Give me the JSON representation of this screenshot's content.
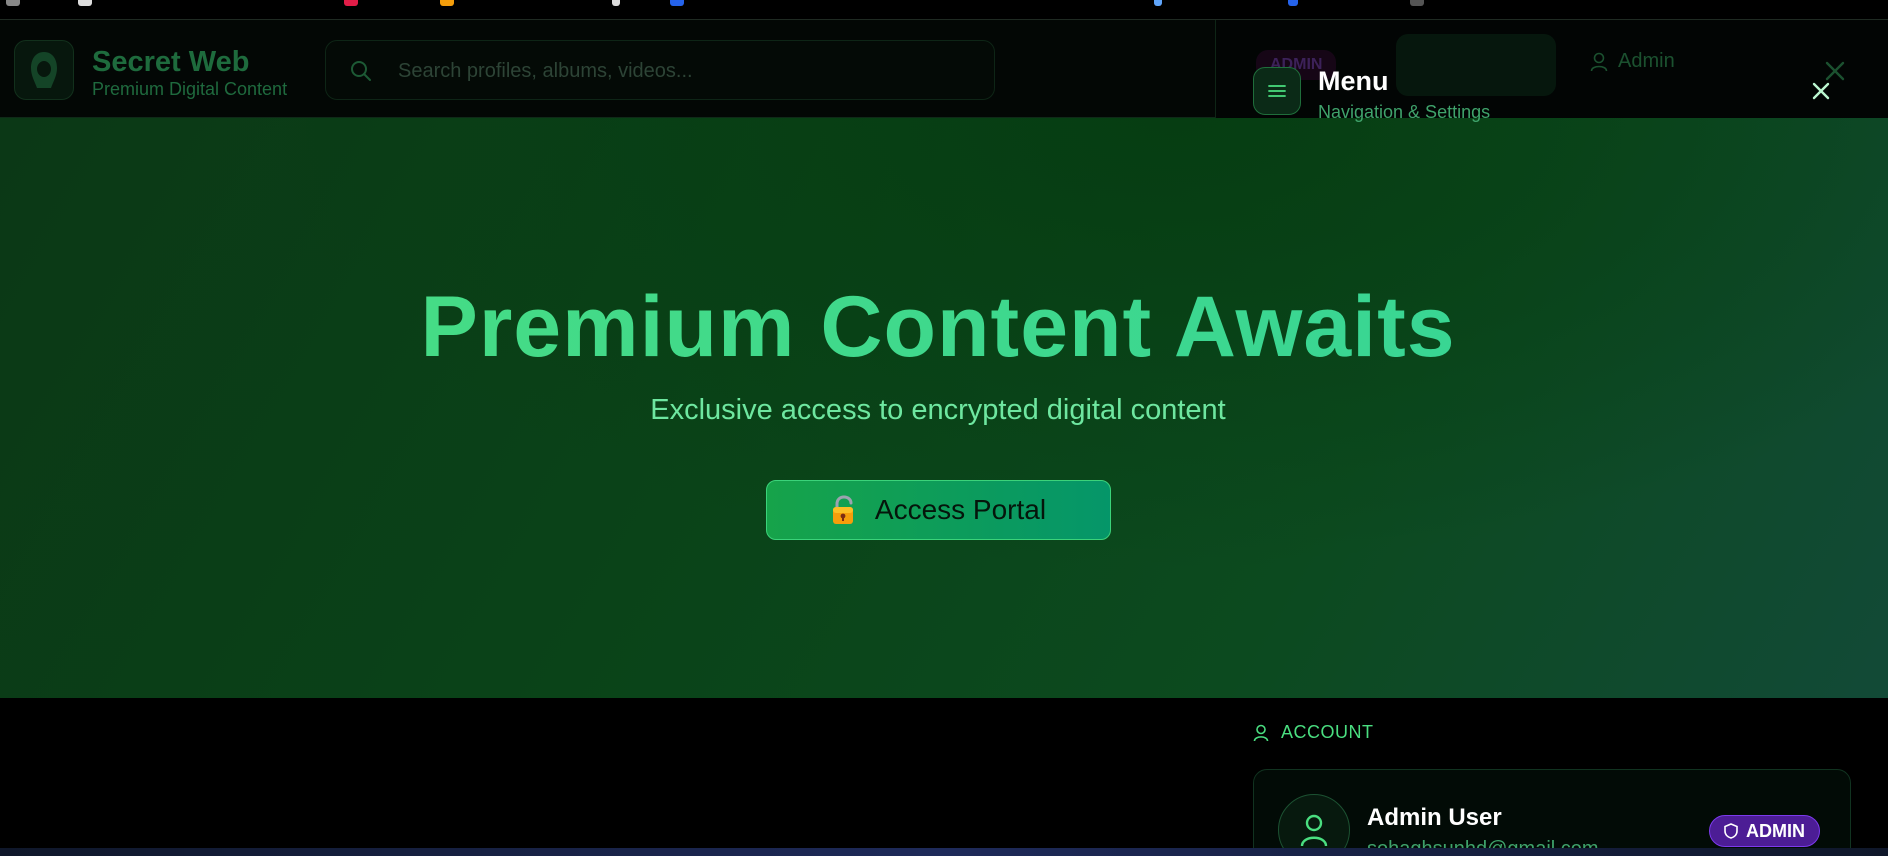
{
  "brand": {
    "title": "Secret Web",
    "subtitle": "Premium Digital Content"
  },
  "search": {
    "placeholder": "Search profiles, albums, videos..."
  },
  "hero": {
    "title": "Premium Content Awaits",
    "subtitle": "Exclusive access to encrypted digital content",
    "cta_label": "Access Portal",
    "cta_icon": "unlocked-padlock-icon"
  },
  "header_ghost": {
    "admin_badge": "ADMIN",
    "user_label": "Admin"
  },
  "menu": {
    "title": "Menu",
    "subtitle": "Navigation & Settings"
  },
  "account": {
    "section_label": "ACCOUNT",
    "name": "Admin User",
    "email": "sohaghsunhd@gmail.com",
    "role_badge": "ADMIN"
  },
  "colors": {
    "accent": "#4ade80",
    "hero_bg": "#0a4318",
    "badge_purple": "#4c1d95"
  }
}
